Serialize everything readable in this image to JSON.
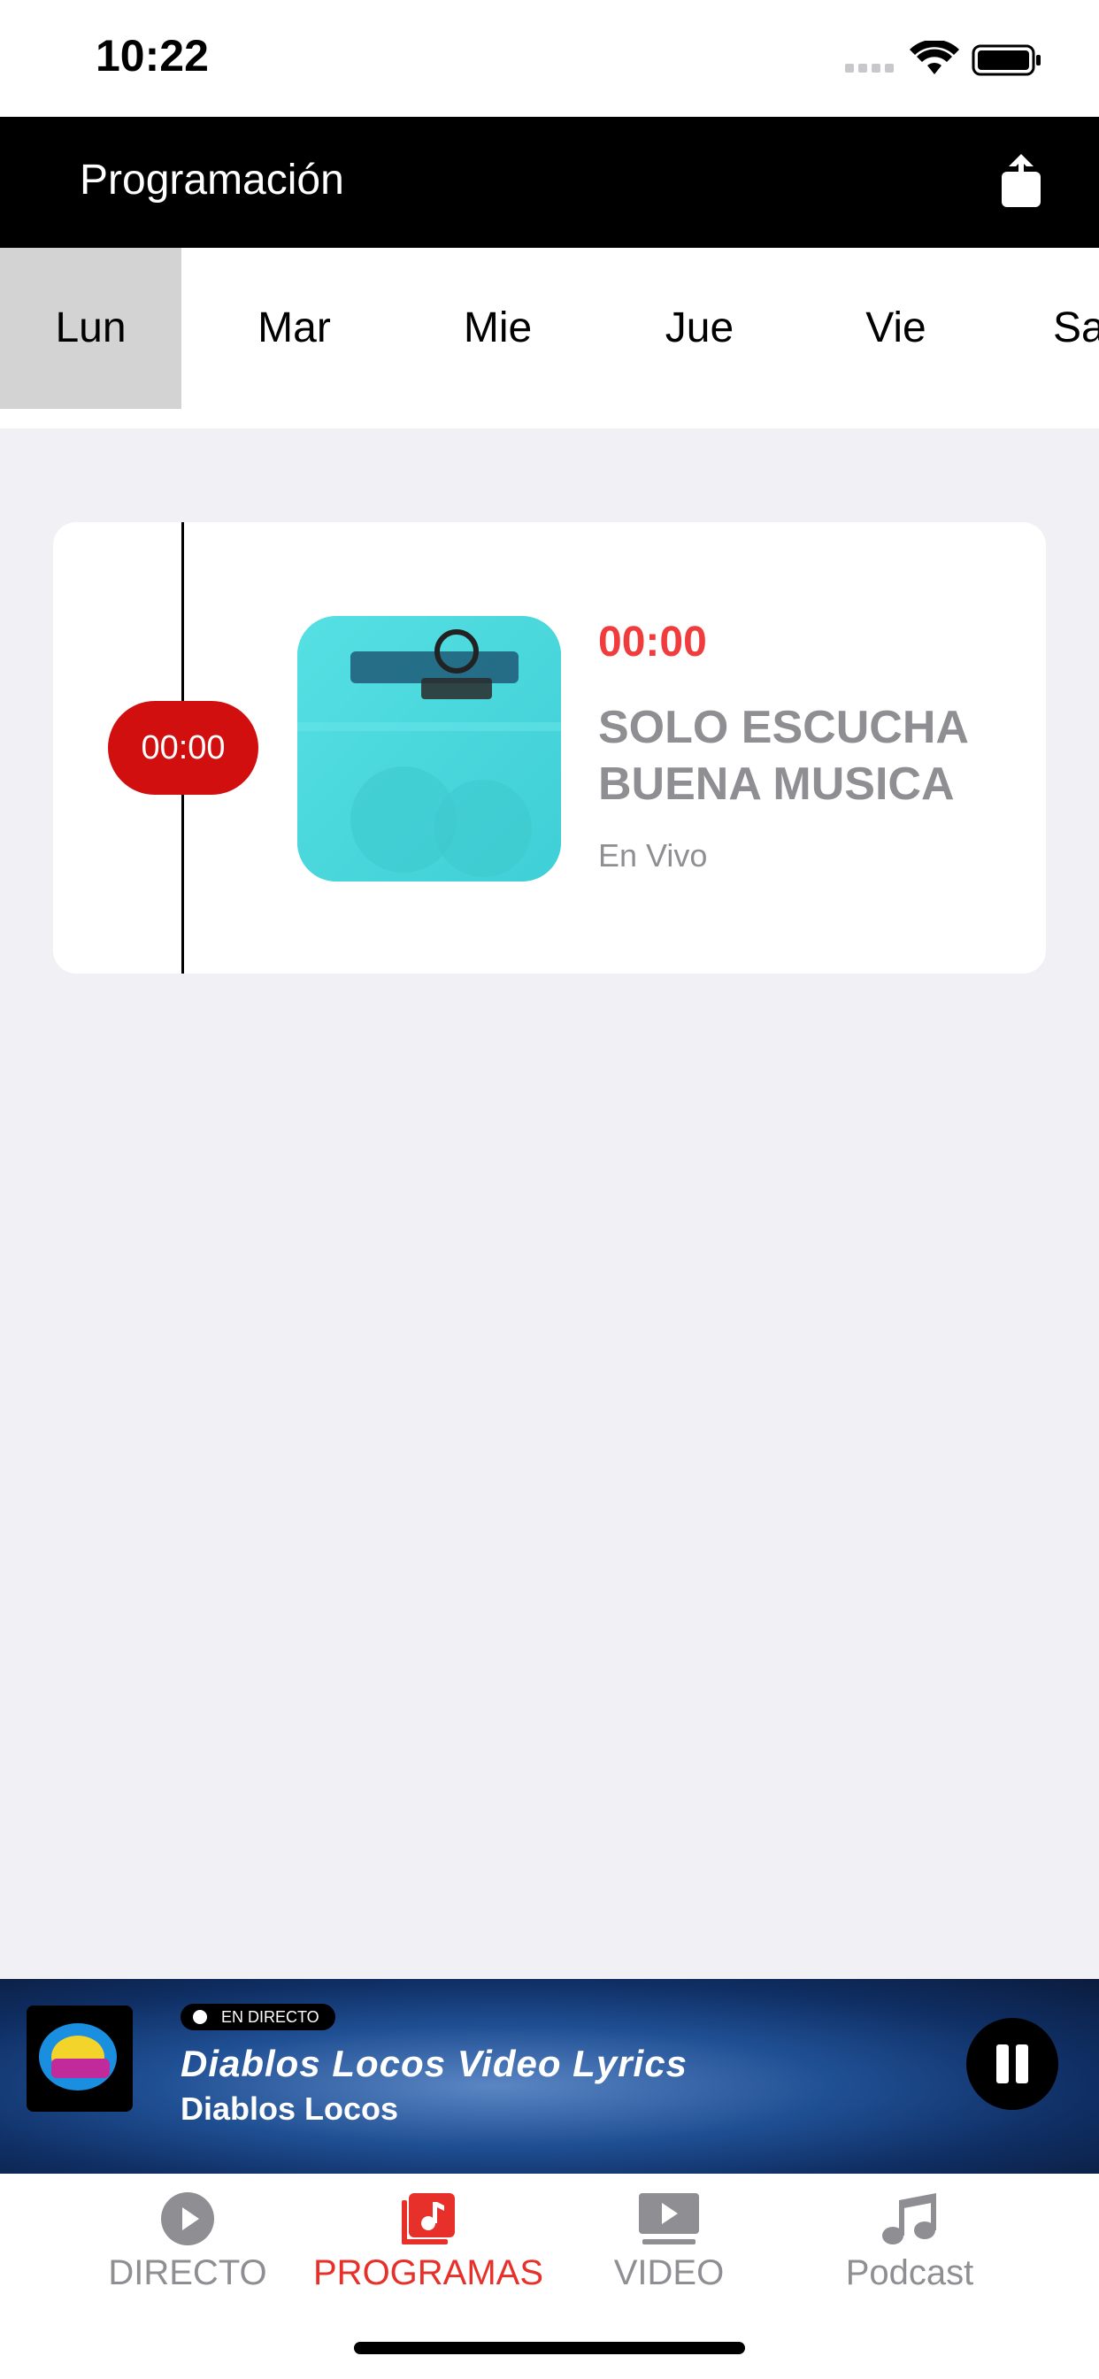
{
  "status_bar": {
    "time": "10:22"
  },
  "header": {
    "title": "Programación",
    "share_icon": "share-icon"
  },
  "days": [
    {
      "label": "Lun",
      "active": true
    },
    {
      "label": "Mar",
      "active": false
    },
    {
      "label": "Mie",
      "active": false
    },
    {
      "label": "Jue",
      "active": false
    },
    {
      "label": "Vie",
      "active": false
    },
    {
      "label": "Sab",
      "active": false
    }
  ],
  "program": {
    "timeline_time": "00:00",
    "time": "00:00",
    "title": "SOLO ESCUCHA BUENA MUSICA",
    "subtitle": "En Vivo"
  },
  "now_playing": {
    "badge": "EN DIRECTO",
    "title": "Diablos Locos Video Lyrics",
    "artist": "Diablos Locos"
  },
  "tab_bar": {
    "tabs": [
      {
        "label": "DIRECTO",
        "icon": "play-icon",
        "active": false
      },
      {
        "label": "PROGRAMAS",
        "icon": "music-note-icon",
        "active": true
      },
      {
        "label": "VIDEO",
        "icon": "video-icon",
        "active": false
      },
      {
        "label": "Podcast",
        "icon": "music-notes-icon",
        "active": false
      }
    ]
  },
  "colors": {
    "accent": "#e8302b",
    "pill": "#d10f0f",
    "header": "#000000",
    "tab_active_bg": "#d3d3d3"
  }
}
